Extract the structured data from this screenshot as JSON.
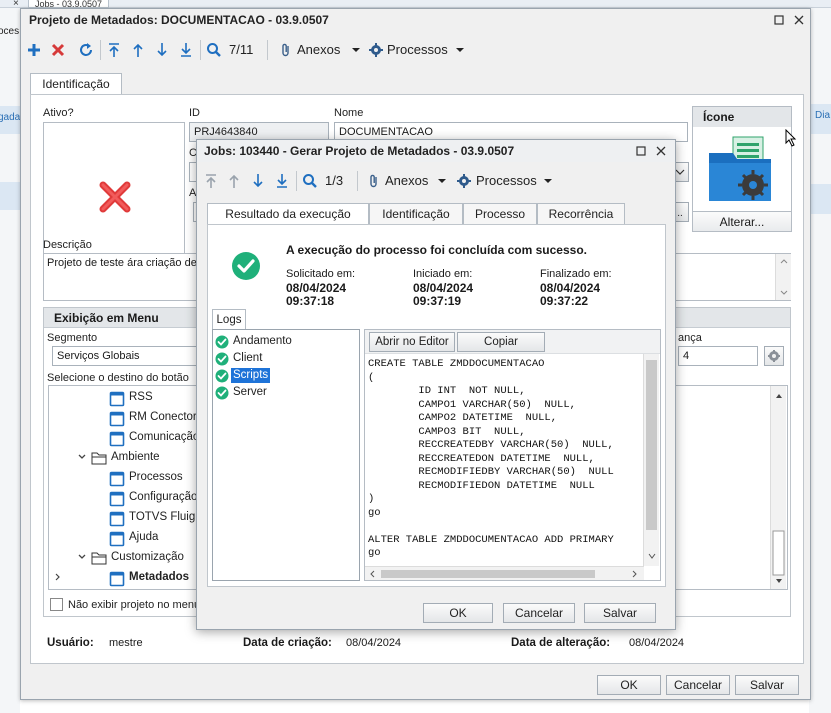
{
  "background": {
    "tab_label": "Jobs - 03.9.0507",
    "tab_close": "×",
    "left_fragment_1": "oces",
    "left_fragment_2": "gada",
    "right_fragment": "Dia"
  },
  "main": {
    "title": "Projeto de Metadados: DOCUMENTACAO - 03.9.0507",
    "toolbar": {
      "record_counter": "7/11",
      "anexos": "Anexos",
      "processos": "Processos"
    },
    "tabs": [
      "Identificação"
    ],
    "fields": {
      "ativo_label": "Ativo?",
      "id_label": "ID",
      "id_value": "PRJ4643840",
      "nome_label": "Nome",
      "nome_value": "DOCUMENTACAO",
      "hidden_label_c": "C",
      "hidden_label_a": "A",
      "icone_label": "Ícone",
      "alterar_button": "Alterar...",
      "descricao_label": "Descrição",
      "descricao_value": "Projeto de teste ára criação de"
    },
    "menu_section": {
      "title": "Exibição em Menu",
      "segmento_label": "Segmento",
      "segmento_value": "Serviços Globais",
      "destino_label": "Selecione o destino do botão",
      "right_label": "ança",
      "right_value": "4",
      "tree": [
        {
          "label": "RSS",
          "type": "page",
          "level": 2
        },
        {
          "label": "RM Conector",
          "type": "page",
          "level": 2
        },
        {
          "label": "Comunicação",
          "type": "page",
          "level": 2
        },
        {
          "label": "Ambiente",
          "type": "folder",
          "level": 1,
          "expanded": true
        },
        {
          "label": "Processos",
          "type": "page",
          "level": 2
        },
        {
          "label": "Configuração",
          "type": "page",
          "level": 2
        },
        {
          "label": "TOTVS Fluig",
          "type": "page",
          "level": 2
        },
        {
          "label": "Ajuda",
          "type": "page",
          "level": 2
        },
        {
          "label": "Customização",
          "type": "folder",
          "level": 1,
          "expanded": true
        },
        {
          "label": "Metadados",
          "type": "page",
          "level": 2,
          "bold": true
        }
      ],
      "checkbox_label": "Não exibir projeto no menu"
    },
    "footer": {
      "usuario_label": "Usuário:",
      "usuario_value": "mestre",
      "criacao_label": "Data de criação:",
      "criacao_value": "08/04/2024",
      "alteracao_label": "Data de alteração:",
      "alteracao_value": "08/04/2024"
    },
    "buttons": {
      "ok": "OK",
      "cancel": "Cancelar",
      "save": "Salvar"
    }
  },
  "jobs": {
    "title": "Jobs: 103440 - Gerar Projeto de Metadados - 03.9.0507",
    "toolbar": {
      "record_counter": "1/3",
      "anexos": "Anexos",
      "processos": "Processos"
    },
    "tabs": [
      "Resultado da execução",
      "Identificação",
      "Processo",
      "Recorrência"
    ],
    "success_message": "A execução do processo foi concluída com sucesso.",
    "times": [
      {
        "label": "Solicitado em:",
        "date": "08/04/2024",
        "time": "09:37:18"
      },
      {
        "label": "Iniciado em:",
        "date": "08/04/2024",
        "time": "09:37:19"
      },
      {
        "label": "Finalizado em:",
        "date": "08/04/2024",
        "time": "09:37:22"
      }
    ],
    "logs_tab": "Logs",
    "log_items": [
      "Andamento",
      "Client",
      "Scripts",
      "Server"
    ],
    "selected_log": "Scripts",
    "open_editor": "Abrir no Editor",
    "copy": "Copiar",
    "code": "CREATE TABLE ZMDDOCUMENTACAO\n(\n        ID INT  NOT NULL,\n        CAMPO1 VARCHAR(50)  NULL,\n        CAMPO2 DATETIME  NULL,\n        CAMPO3 BIT  NULL,\n        RECCREATEDBY VARCHAR(50)  NULL,\n        RECCREATEDON DATETIME  NULL,\n        RECMODIFIEDBY VARCHAR(50)  NULL\n        RECMODIFIEDON DATETIME  NULL\n)\ngo\n\nALTER TABLE ZMDDOCUMENTACAO ADD PRIMARY\ngo",
    "buttons": {
      "ok": "OK",
      "cancel": "Cancelar",
      "save": "Salvar"
    }
  },
  "colors": {
    "accent_blue": "#2a7ac8",
    "delete_red": "#d63a3a",
    "success_green": "#1fb07a",
    "selection_blue": "#1e73d8"
  },
  "icons": [
    "add-icon",
    "delete-icon",
    "refresh-icon",
    "first-icon",
    "prev-icon",
    "next-icon",
    "last-icon",
    "search-icon",
    "paperclip-icon",
    "gear-icon",
    "chevron-down-icon",
    "minimize-icon",
    "close-icon",
    "check-icon",
    "red-x-icon",
    "folder-icon",
    "page-icon"
  ]
}
